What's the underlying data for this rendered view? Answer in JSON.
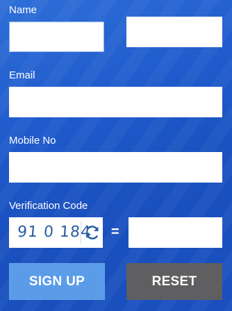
{
  "form": {
    "name_label": "Name",
    "first_name": {
      "value": "",
      "placeholder": ""
    },
    "last_name": {
      "value": "",
      "placeholder": ""
    },
    "email_label": "Email",
    "email": {
      "value": "",
      "placeholder": ""
    },
    "mobile_label": "Mobile No",
    "mobile": {
      "value": "",
      "placeholder": ""
    },
    "verification_label": "Verification Code",
    "captcha_text": "91 0 184",
    "equals_sign": "=",
    "verification_input": {
      "value": "",
      "placeholder": ""
    }
  },
  "buttons": {
    "signup_label": "SIGN UP",
    "reset_label": "RESET"
  },
  "icons": {
    "refresh": "refresh-icon"
  },
  "colors": {
    "background": "#1f5bcc",
    "signup_button": "#5b9ce8",
    "reset_button": "#5f5f61",
    "captcha_text": "#2b5fa3"
  }
}
